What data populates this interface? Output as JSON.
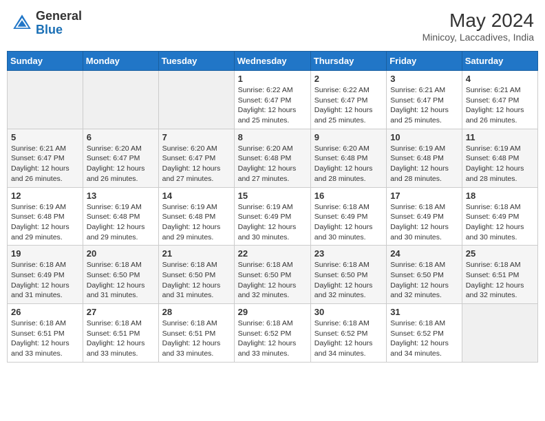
{
  "header": {
    "logo_general": "General",
    "logo_blue": "Blue",
    "month_year": "May 2024",
    "location": "Minicoy, Laccadives, India"
  },
  "days_of_week": [
    "Sunday",
    "Monday",
    "Tuesday",
    "Wednesday",
    "Thursday",
    "Friday",
    "Saturday"
  ],
  "weeks": [
    [
      {
        "day": "",
        "sunrise": "",
        "sunset": "",
        "daylight": ""
      },
      {
        "day": "",
        "sunrise": "",
        "sunset": "",
        "daylight": ""
      },
      {
        "day": "",
        "sunrise": "",
        "sunset": "",
        "daylight": ""
      },
      {
        "day": "1",
        "sunrise": "6:22 AM",
        "sunset": "6:47 PM",
        "daylight": "12 hours and 25 minutes."
      },
      {
        "day": "2",
        "sunrise": "6:22 AM",
        "sunset": "6:47 PM",
        "daylight": "12 hours and 25 minutes."
      },
      {
        "day": "3",
        "sunrise": "6:21 AM",
        "sunset": "6:47 PM",
        "daylight": "12 hours and 25 minutes."
      },
      {
        "day": "4",
        "sunrise": "6:21 AM",
        "sunset": "6:47 PM",
        "daylight": "12 hours and 26 minutes."
      }
    ],
    [
      {
        "day": "5",
        "sunrise": "6:21 AM",
        "sunset": "6:47 PM",
        "daylight": "12 hours and 26 minutes."
      },
      {
        "day": "6",
        "sunrise": "6:20 AM",
        "sunset": "6:47 PM",
        "daylight": "12 hours and 26 minutes."
      },
      {
        "day": "7",
        "sunrise": "6:20 AM",
        "sunset": "6:47 PM",
        "daylight": "12 hours and 27 minutes."
      },
      {
        "day": "8",
        "sunrise": "6:20 AM",
        "sunset": "6:48 PM",
        "daylight": "12 hours and 27 minutes."
      },
      {
        "day": "9",
        "sunrise": "6:20 AM",
        "sunset": "6:48 PM",
        "daylight": "12 hours and 28 minutes."
      },
      {
        "day": "10",
        "sunrise": "6:19 AM",
        "sunset": "6:48 PM",
        "daylight": "12 hours and 28 minutes."
      },
      {
        "day": "11",
        "sunrise": "6:19 AM",
        "sunset": "6:48 PM",
        "daylight": "12 hours and 28 minutes."
      }
    ],
    [
      {
        "day": "12",
        "sunrise": "6:19 AM",
        "sunset": "6:48 PM",
        "daylight": "12 hours and 29 minutes."
      },
      {
        "day": "13",
        "sunrise": "6:19 AM",
        "sunset": "6:48 PM",
        "daylight": "12 hours and 29 minutes."
      },
      {
        "day": "14",
        "sunrise": "6:19 AM",
        "sunset": "6:48 PM",
        "daylight": "12 hours and 29 minutes."
      },
      {
        "day": "15",
        "sunrise": "6:19 AM",
        "sunset": "6:49 PM",
        "daylight": "12 hours and 30 minutes."
      },
      {
        "day": "16",
        "sunrise": "6:18 AM",
        "sunset": "6:49 PM",
        "daylight": "12 hours and 30 minutes."
      },
      {
        "day": "17",
        "sunrise": "6:18 AM",
        "sunset": "6:49 PM",
        "daylight": "12 hours and 30 minutes."
      },
      {
        "day": "18",
        "sunrise": "6:18 AM",
        "sunset": "6:49 PM",
        "daylight": "12 hours and 30 minutes."
      }
    ],
    [
      {
        "day": "19",
        "sunrise": "6:18 AM",
        "sunset": "6:49 PM",
        "daylight": "12 hours and 31 minutes."
      },
      {
        "day": "20",
        "sunrise": "6:18 AM",
        "sunset": "6:50 PM",
        "daylight": "12 hours and 31 minutes."
      },
      {
        "day": "21",
        "sunrise": "6:18 AM",
        "sunset": "6:50 PM",
        "daylight": "12 hours and 31 minutes."
      },
      {
        "day": "22",
        "sunrise": "6:18 AM",
        "sunset": "6:50 PM",
        "daylight": "12 hours and 32 minutes."
      },
      {
        "day": "23",
        "sunrise": "6:18 AM",
        "sunset": "6:50 PM",
        "daylight": "12 hours and 32 minutes."
      },
      {
        "day": "24",
        "sunrise": "6:18 AM",
        "sunset": "6:50 PM",
        "daylight": "12 hours and 32 minutes."
      },
      {
        "day": "25",
        "sunrise": "6:18 AM",
        "sunset": "6:51 PM",
        "daylight": "12 hours and 32 minutes."
      }
    ],
    [
      {
        "day": "26",
        "sunrise": "6:18 AM",
        "sunset": "6:51 PM",
        "daylight": "12 hours and 33 minutes."
      },
      {
        "day": "27",
        "sunrise": "6:18 AM",
        "sunset": "6:51 PM",
        "daylight": "12 hours and 33 minutes."
      },
      {
        "day": "28",
        "sunrise": "6:18 AM",
        "sunset": "6:51 PM",
        "daylight": "12 hours and 33 minutes."
      },
      {
        "day": "29",
        "sunrise": "6:18 AM",
        "sunset": "6:52 PM",
        "daylight": "12 hours and 33 minutes."
      },
      {
        "day": "30",
        "sunrise": "6:18 AM",
        "sunset": "6:52 PM",
        "daylight": "12 hours and 34 minutes."
      },
      {
        "day": "31",
        "sunrise": "6:18 AM",
        "sunset": "6:52 PM",
        "daylight": "12 hours and 34 minutes."
      },
      {
        "day": "",
        "sunrise": "",
        "sunset": "",
        "daylight": ""
      }
    ]
  ]
}
